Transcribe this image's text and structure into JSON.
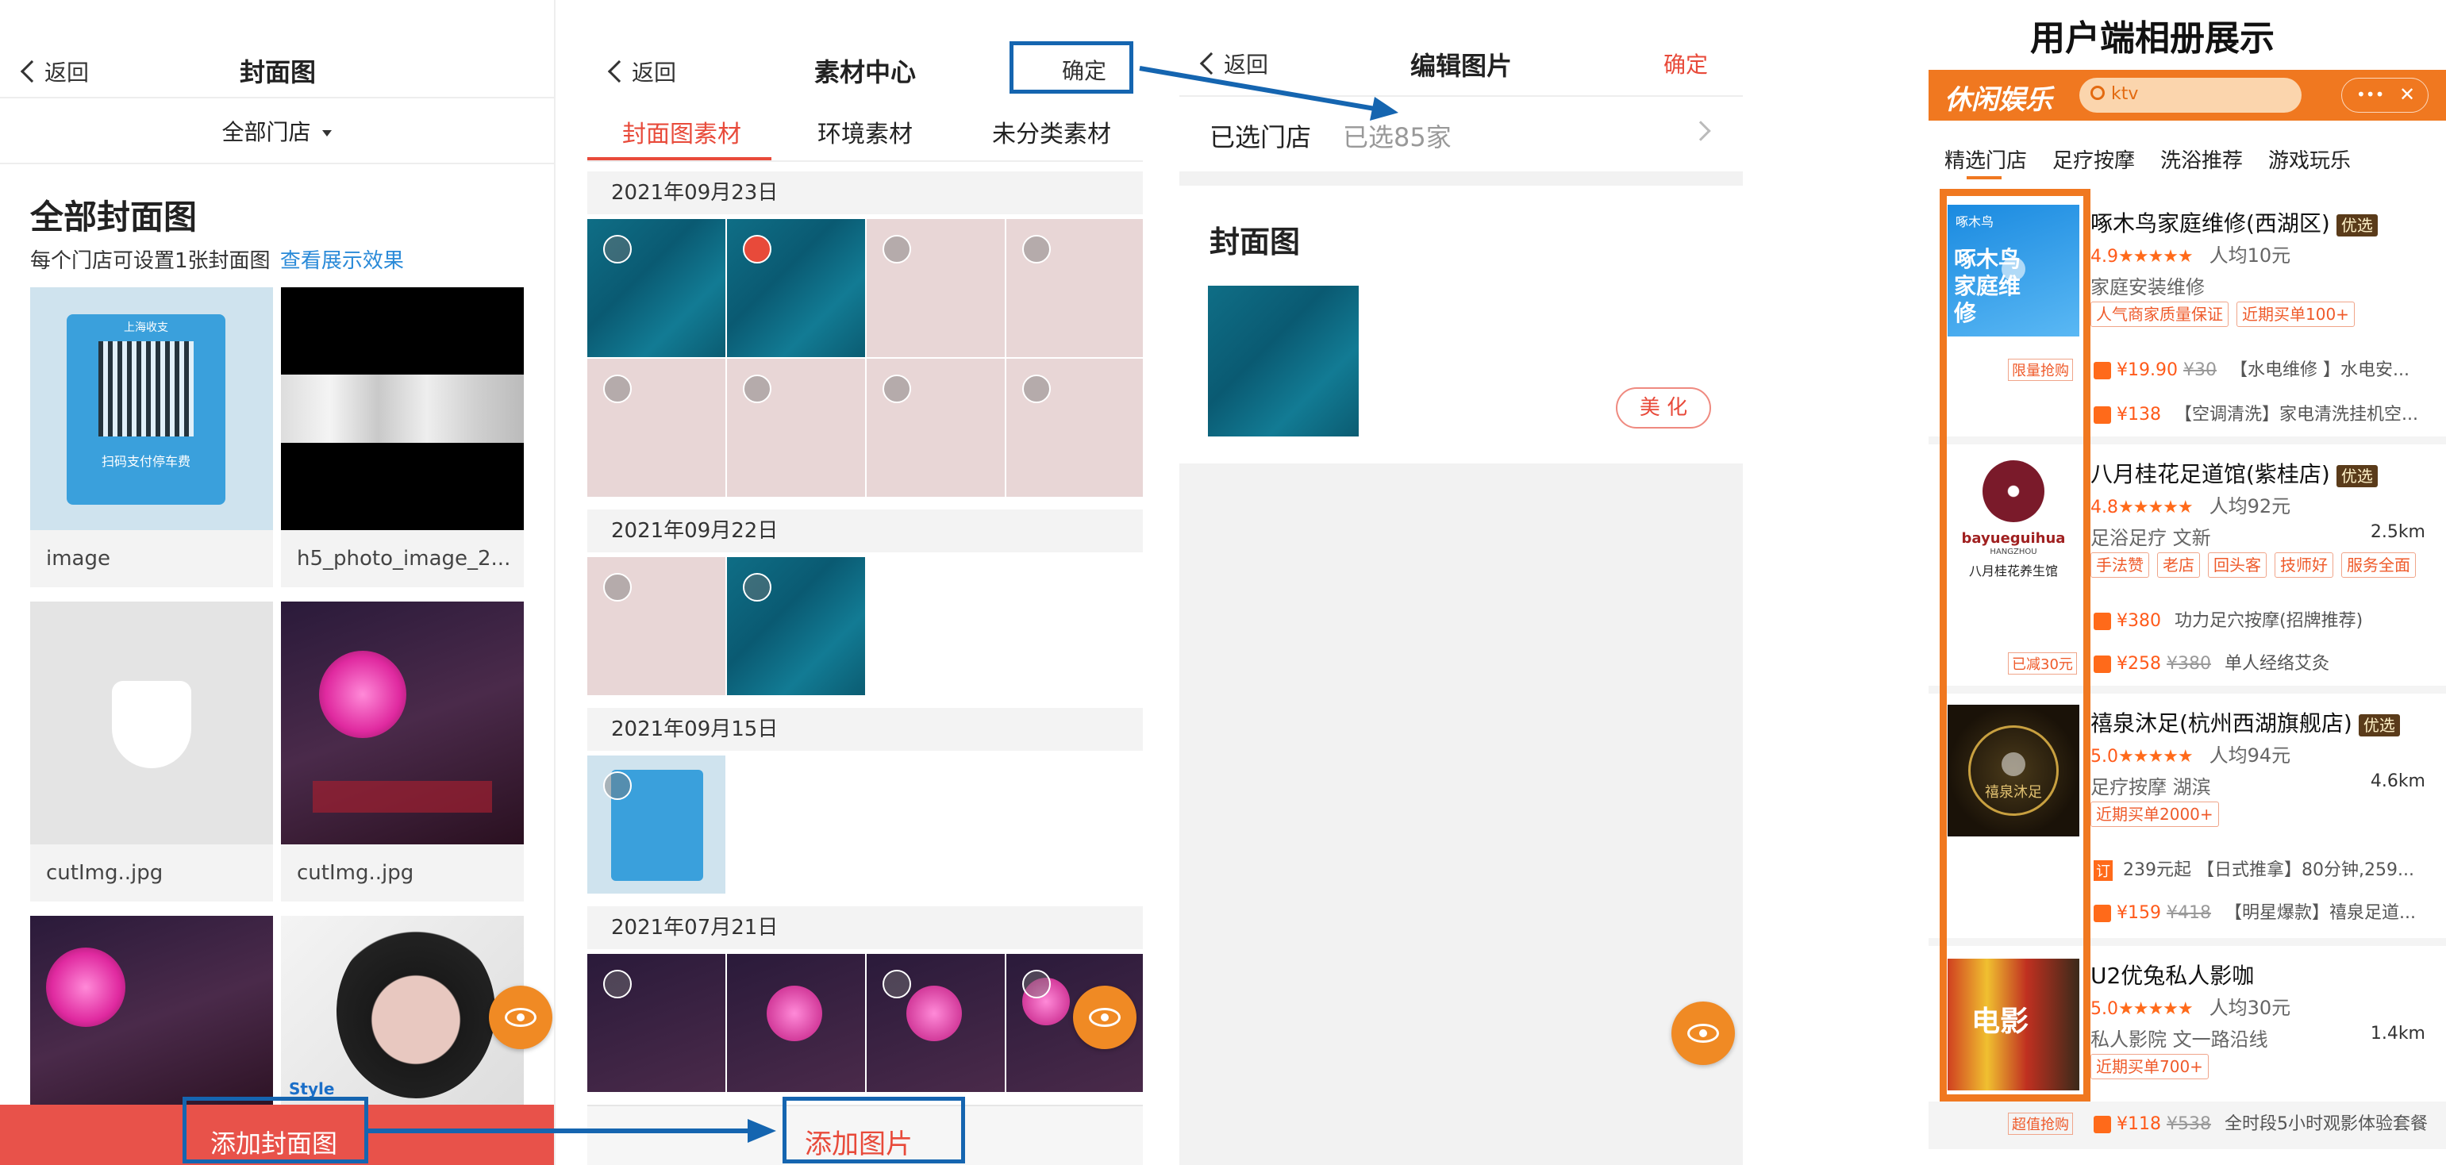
{
  "panel1": {
    "back": "返回",
    "title": "封面图",
    "store_filter": "全部门店",
    "heading": "全部封面图",
    "subtitle": "每个门店可设置1张封面图",
    "view_link": "查看展示效果",
    "items": [
      {
        "name": "image"
      },
      {
        "name": "h5_photo_image_2..."
      },
      {
        "name": "cutImg..jpg"
      },
      {
        "name": "cutImg..jpg"
      }
    ],
    "thumb1_top_text": "上海收支",
    "thumb1_bottom_text": "扫码支付停车费",
    "thumb_style_text": "Style",
    "add_button": "添加封面图"
  },
  "panel2": {
    "back": "返回",
    "title": "素材中心",
    "confirm": "确定",
    "tabs": [
      "封面图素材",
      "环境素材",
      "未分类素材"
    ],
    "dates": [
      "2021年09月23日",
      "2021年09月22日",
      "2021年09月15日",
      "2021年07月21日"
    ],
    "add_button": "添加图片"
  },
  "panel3": {
    "back": "返回",
    "title": "编辑图片",
    "confirm": "确定",
    "store_label": "已选门店",
    "store_value": "已选85家",
    "section_title": "封面图",
    "beautify": "美 化"
  },
  "panel4": {
    "heading": "用户端相册展示",
    "brand": "休闲娱乐",
    "search_value": "ktv",
    "capsule_dots": "•••",
    "capsule_close": "✕",
    "tabs": [
      "精选门店",
      "足疗按摩",
      "洗浴推荐",
      "游戏玩乐"
    ],
    "stores": [
      {
        "name": "啄木鸟家庭维修(西湖区)",
        "badge": "优选",
        "rating": "4.9",
        "stars": "★★★★★",
        "avg": "人均10元",
        "category": "家庭安装维修",
        "distance": "",
        "tags": [
          "人气商家质量保证",
          "近期买单100+"
        ],
        "thumb_text": "啄木鸟家庭维修",
        "thumb_logo": "啄木鸟",
        "promo": "限量抢购",
        "deals": [
          {
            "price": "¥19.90",
            "orig": "¥30",
            "desc": "【水电维修 】水电安..."
          },
          {
            "price": "¥138",
            "orig": "",
            "desc": "【空调清洗】家电清洗挂机空..."
          }
        ]
      },
      {
        "name": "八月桂花足道馆(紫桂店)",
        "badge": "优选",
        "rating": "4.8",
        "stars": "★★★★★",
        "avg": "人均92元",
        "category": "足浴足疗  文新",
        "distance": "2.5km",
        "tags": [
          "手法赞",
          "老店",
          "回头客",
          "技师好",
          "服务全面"
        ],
        "thumb_text": "bayueguihua",
        "thumb_sub": "HANGZHOU",
        "thumb_cn": "八月桂花养生馆",
        "promo": "已减30元",
        "deals": [
          {
            "price": "¥380",
            "orig": "",
            "desc": "功力足穴按摩(招牌推荐)"
          },
          {
            "price": "¥258",
            "orig": "¥380",
            "desc": "单人经络艾灸"
          }
        ]
      },
      {
        "name": "禧泉沐足(杭州西湖旗舰店)",
        "badge": "优选",
        "rating": "5.0",
        "stars": "★★★★★",
        "avg": "人均94元",
        "category": "足疗按摩  湖滨",
        "distance": "4.6km",
        "tags": [
          "近期买单2000+"
        ],
        "thumb_text": "禧泉沐足",
        "promo": "",
        "deals": [
          {
            "price": "",
            "orig": "",
            "prefix": "订",
            "desc": "239元起 【日式推拿】80分钟,259..."
          },
          {
            "price": "¥159",
            "orig": "¥418",
            "desc": "【明星爆款】禧泉足道..."
          }
        ]
      },
      {
        "name": "U2优兔私人影咖",
        "badge": "",
        "rating": "5.0",
        "stars": "★★★★★",
        "avg": "人均30元",
        "category": "私人影院  文一路沿线",
        "distance": "1.4km",
        "tags": [
          "近期买单700+"
        ],
        "thumb_text": "电影",
        "promo": "超值抢购",
        "deals": [
          {
            "price": "¥118",
            "orig": "¥538",
            "desc": "全时段5小时观影体验套餐"
          }
        ]
      }
    ]
  },
  "colors": {
    "accent_red": "#e84a3a",
    "highlight_blue": "#1565b0",
    "orange": "#f08a24",
    "user_highlight": "#f07820"
  }
}
